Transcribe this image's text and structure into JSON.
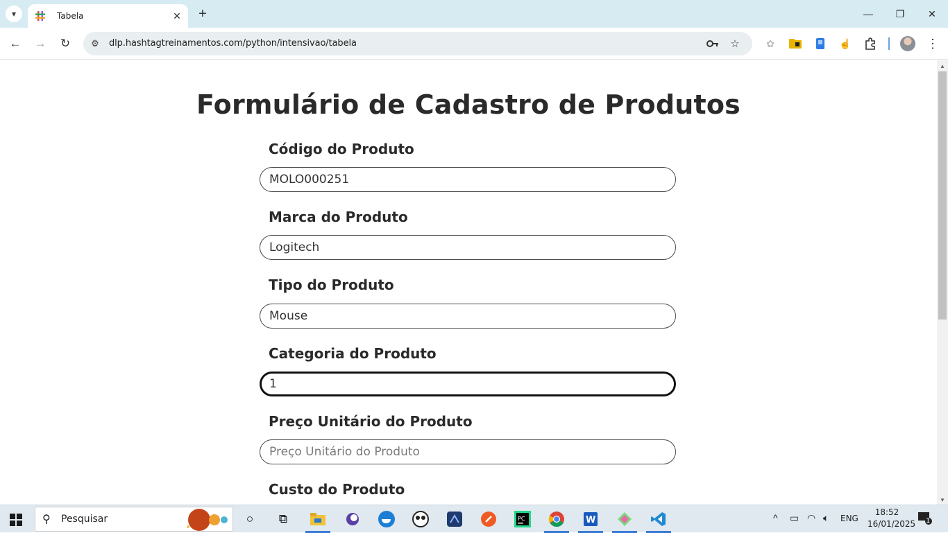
{
  "browser": {
    "tab_title": "Tabela",
    "url": "dlp.hashtagtreinamentos.com/python/intensivao/tabela"
  },
  "form": {
    "title": "Formulário de Cadastro de Produtos",
    "fields": [
      {
        "label": "Código do Produto",
        "value": "MOLO000251",
        "placeholder": "Código do Produto"
      },
      {
        "label": "Marca do Produto",
        "value": "Logitech",
        "placeholder": "Marca do Produto"
      },
      {
        "label": "Tipo do Produto",
        "value": "Mouse",
        "placeholder": "Tipo do Produto"
      },
      {
        "label": "Categoria do Produto",
        "value": "1",
        "placeholder": "Categoria do Produto"
      },
      {
        "label": "Preço Unitário do Produto",
        "value": "",
        "placeholder": "Preço Unitário do Produto"
      },
      {
        "label": "Custo do Produto"
      }
    ]
  },
  "taskbar": {
    "search_placeholder": "Pesquisar",
    "language": "ENG",
    "time": "18:52",
    "date": "16/01/2025",
    "notification_count": "1"
  }
}
